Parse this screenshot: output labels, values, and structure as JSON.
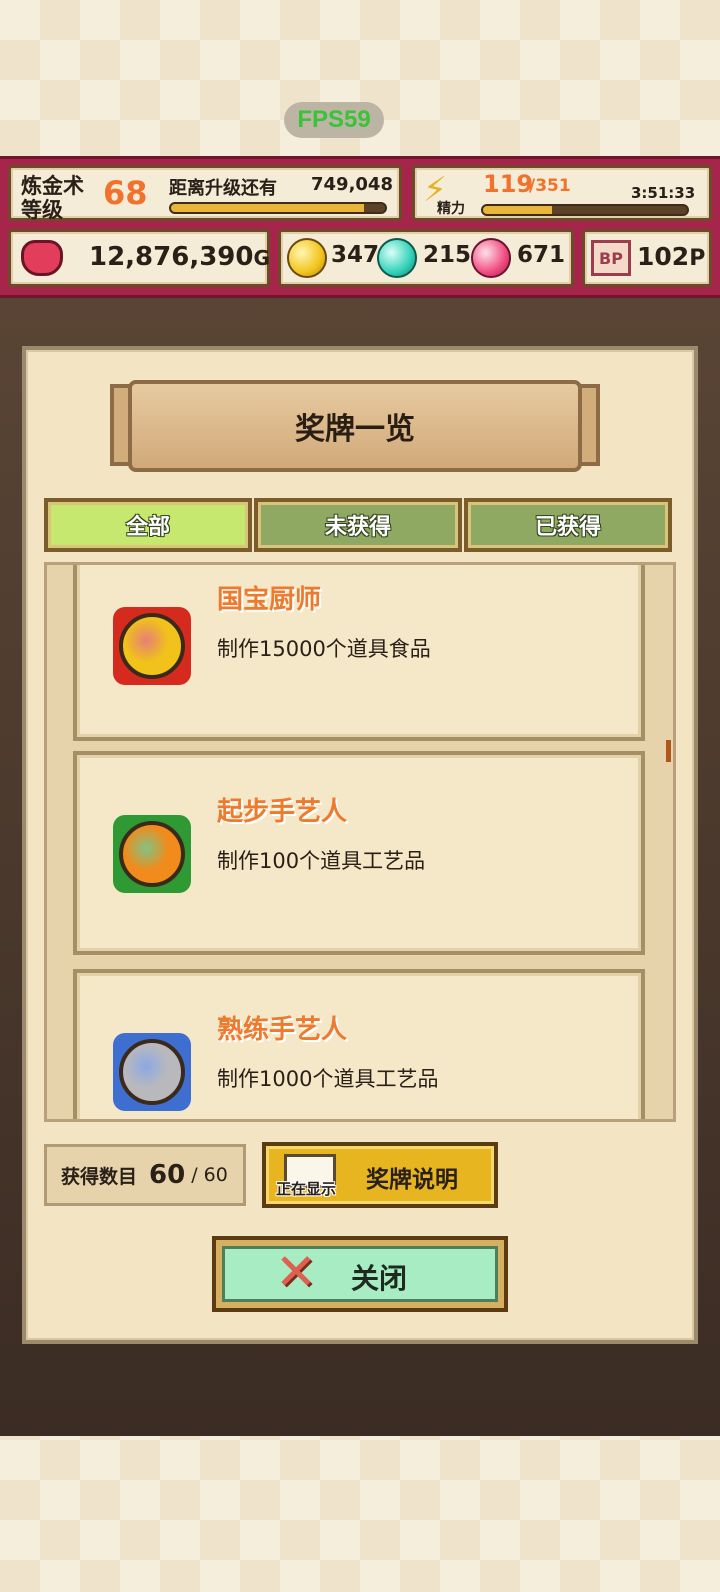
{
  "fps": "FPS59",
  "status": {
    "level_label_1": "炼金术",
    "level_label_2": "等级",
    "level": "68",
    "exp_label": "距离升级还有",
    "exp_remaining": "749,048",
    "exp_progress": 0.9,
    "energy_label": "精力",
    "energy_current": "119",
    "energy_max": "/351",
    "energy_timer": "3:51:33",
    "energy_progress": 0.34,
    "gold": "12,876,390",
    "gold_unit": "G",
    "gem_yellow": "347",
    "gem_cyan": "215",
    "gem_pink": "671",
    "bp_icon": "BP",
    "bp_value": "102",
    "bp_unit": "P"
  },
  "panel": {
    "title": "奖牌一览",
    "tabs": [
      {
        "label": "全部",
        "active": true
      },
      {
        "label": "未获得",
        "active": false
      },
      {
        "label": "已获得",
        "active": false
      }
    ],
    "medals": [
      {
        "title": "国宝厨师",
        "desc": "制作15000个道具食品",
        "color": "#f1c21a",
        "ribbon": "#d52a1e",
        "icon": "gold-medal-icon"
      },
      {
        "title": "起步手艺人",
        "desc": "制作100个道具工艺品",
        "color": "#f08b1c",
        "ribbon": "#2f9a34",
        "icon": "bronze-medal-icon"
      },
      {
        "title": "熟练手艺人",
        "desc": "制作1000个道具工艺品",
        "color": "#b9b9bd",
        "ribbon": "#3e6fd0",
        "icon": "silver-medal-icon"
      }
    ],
    "count_label": "获得数目",
    "count_value": "60",
    "count_total": "/ 60",
    "explain_badge": "正在显示",
    "explain_label": "奖牌说明",
    "close_label": "关闭"
  }
}
